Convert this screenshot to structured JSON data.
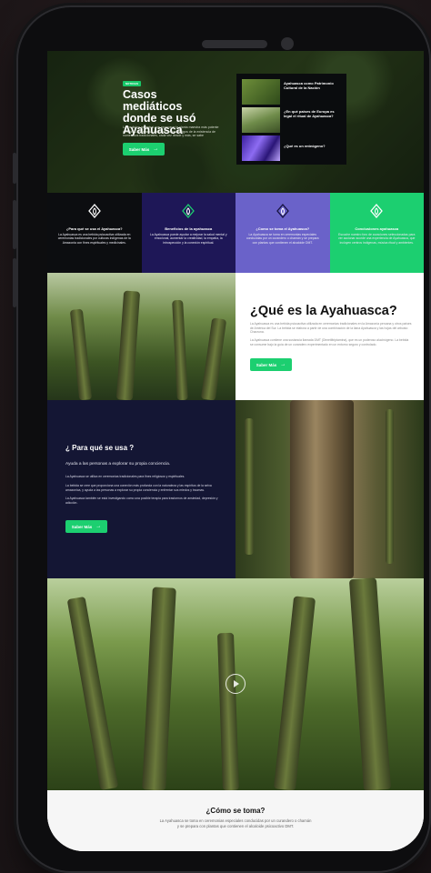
{
  "hero": {
    "badge": "NOTICIAS",
    "title": "Casos mediáticos donde se usó Ayahuasca",
    "description": "La medicina ancestral que promueve la planta maestra más potente conocida Ayahuasca. A raíz de ciertos testigos de la existencia de numerosos tradicionales, cada vez desde y más, se sabe",
    "button_label": "Saber Más",
    "arrow": "→",
    "cards": [
      {
        "title": "Ayahuasca como Patrimonio Cultural de la Nación"
      },
      {
        "title": "¿En qué países de Europa es legal el ritual de Ayahuasca?"
      },
      {
        "title": "¿Qué es un enteógeno?"
      }
    ]
  },
  "features": [
    {
      "title": "¿Para qué se usa el Ayahuasca?",
      "text": "La Ayahuasca es una bebida psicoactiva utilizada en ceremonias tradicionales por culturas indígenas de la Amazonia con fines espirituales y medicinales.",
      "color": "#0c0d10",
      "icon": "ayahuasca-leaf-icon"
    },
    {
      "title": "Beneficios de la ayahuasca",
      "text": "La Ayahuasca puede ayudar a mejorar la salud mental y emocional, aumentar la creatividad, la empatía, la introspección y la conexión espiritual.",
      "color": "#1e1757",
      "icon": "ayahuasca-leaf-icon"
    },
    {
      "title": "¿Como se toma el Ayahuasca?",
      "text": "La Ayahuasca se toma en ceremonias especiales conducidas por un curandero o chamán y se prepara con plantas que contienen el alcaloide DMT.",
      "color": "#6a62c9",
      "icon": "ayahuasca-leaf-icon"
    },
    {
      "title": "Conclusiones ayahuasca",
      "text": "Escuche nuestro foro de curaciones seleccionadas para ver accionar acorde una experiencia de Ayahuasca, que incluyen centros indígenas, música ritual y ambientes.",
      "color": "#1ccf70",
      "icon": "ayahuasca-leaf-icon"
    }
  ],
  "que_es": {
    "title": "¿Qué es la Ayahuasca?",
    "paragraph1": "La Ayahuasca es una bebida psicoactiva utilizada en ceremonias tradicionales en la Amazonía peruana y otros países de América del Sur. La bebida se elabora a partir de una combinación de la liana Ayahuasca y las hojas del arbusto Chacruna.",
    "paragraph2": "La Ayahuasca contiene una sustancia llamada DMT (Dimetiltriptamina), que es un poderoso alucinógeno. La bebida se consume bajo la guía de un curandero experimentado en un entorno seguro y controlado.",
    "button_label": "Saber Más",
    "arrow": "→"
  },
  "para_que": {
    "title": "¿ Para qué se usa ?",
    "subtitle": "Ayuda a las personas a explorar su propia conciencia.",
    "p1": "La Ayahuasca se utiliza en ceremonias tradicionales para fines religiosos y espirituales.",
    "p2": "La bebida se cree que proporciona una conexión más profunda con la naturaleza y las espíritus de la selva amazonica, y ayuda a las personas a explorar su propia conciencia y enfrentar sus miedos y traumas.",
    "p3": "La Ayahuasca también se está investigando como una posible terapia para trastornos de ansiedad, depresión y adicción.",
    "button_label": "Saber Más",
    "arrow": "→"
  },
  "como": {
    "title": "¿Cómo se toma?",
    "text": "La Ayahuasca se toma en ceremonias especiales conducidas por un curandero o chamán y se prepara con plantas que contienen el alcaloide psicoactivo DMT."
  },
  "colors": {
    "accent": "#1ccf70",
    "navy": "#141634"
  }
}
